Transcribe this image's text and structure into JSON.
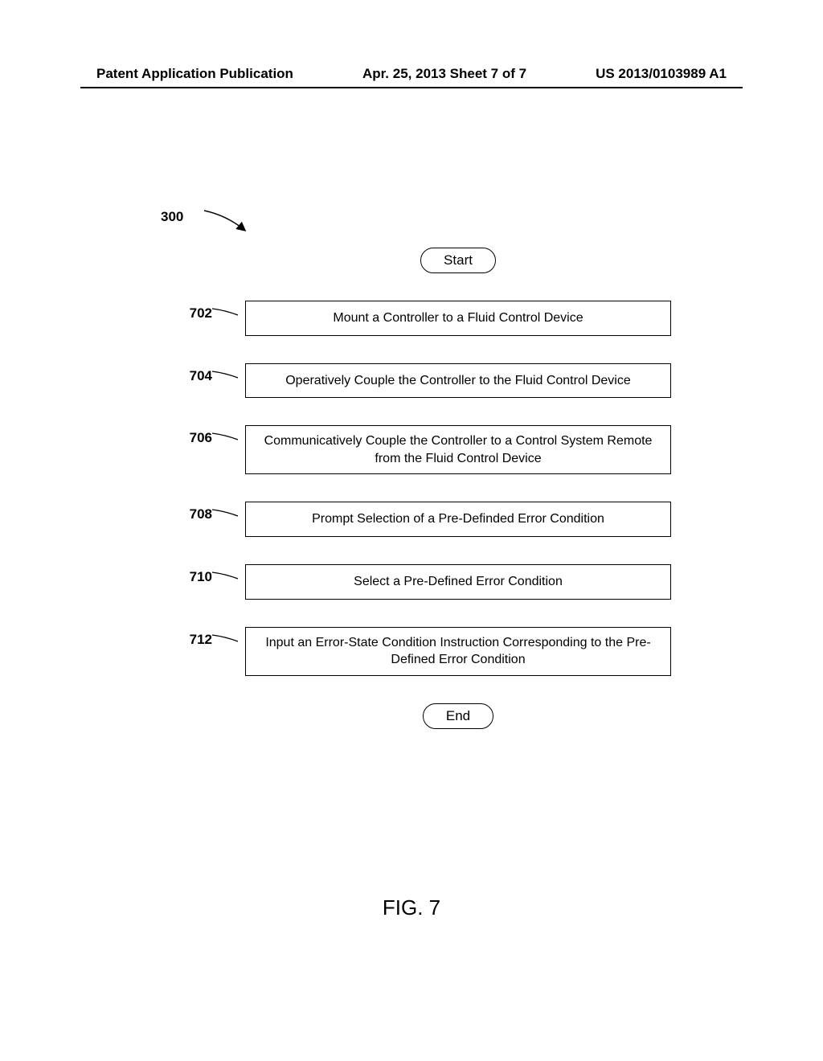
{
  "header": {
    "left": "Patent Application Publication",
    "center": "Apr. 25, 2013  Sheet 7 of 7",
    "right": "US 2013/0103989 A1"
  },
  "chart_data": {
    "type": "flowchart",
    "ref": "300",
    "start": "Start",
    "end": "End",
    "steps": [
      {
        "ref": "702",
        "text": "Mount a Controller to a Fluid Control Device"
      },
      {
        "ref": "704",
        "text": "Operatively Couple the Controller to the Fluid Control Device"
      },
      {
        "ref": "706",
        "text": "Communicatively Couple the Controller to a Control System Remote from the Fluid Control Device"
      },
      {
        "ref": "708",
        "text": "Prompt Selection of a Pre-Definded Error Condition"
      },
      {
        "ref": "710",
        "text": "Select a Pre-Defined Error Condition"
      },
      {
        "ref": "712",
        "text": "Input an Error-State Condition Instruction Corresponding to the Pre-Defined Error Condition"
      }
    ]
  },
  "figure_caption": "FIG. 7"
}
